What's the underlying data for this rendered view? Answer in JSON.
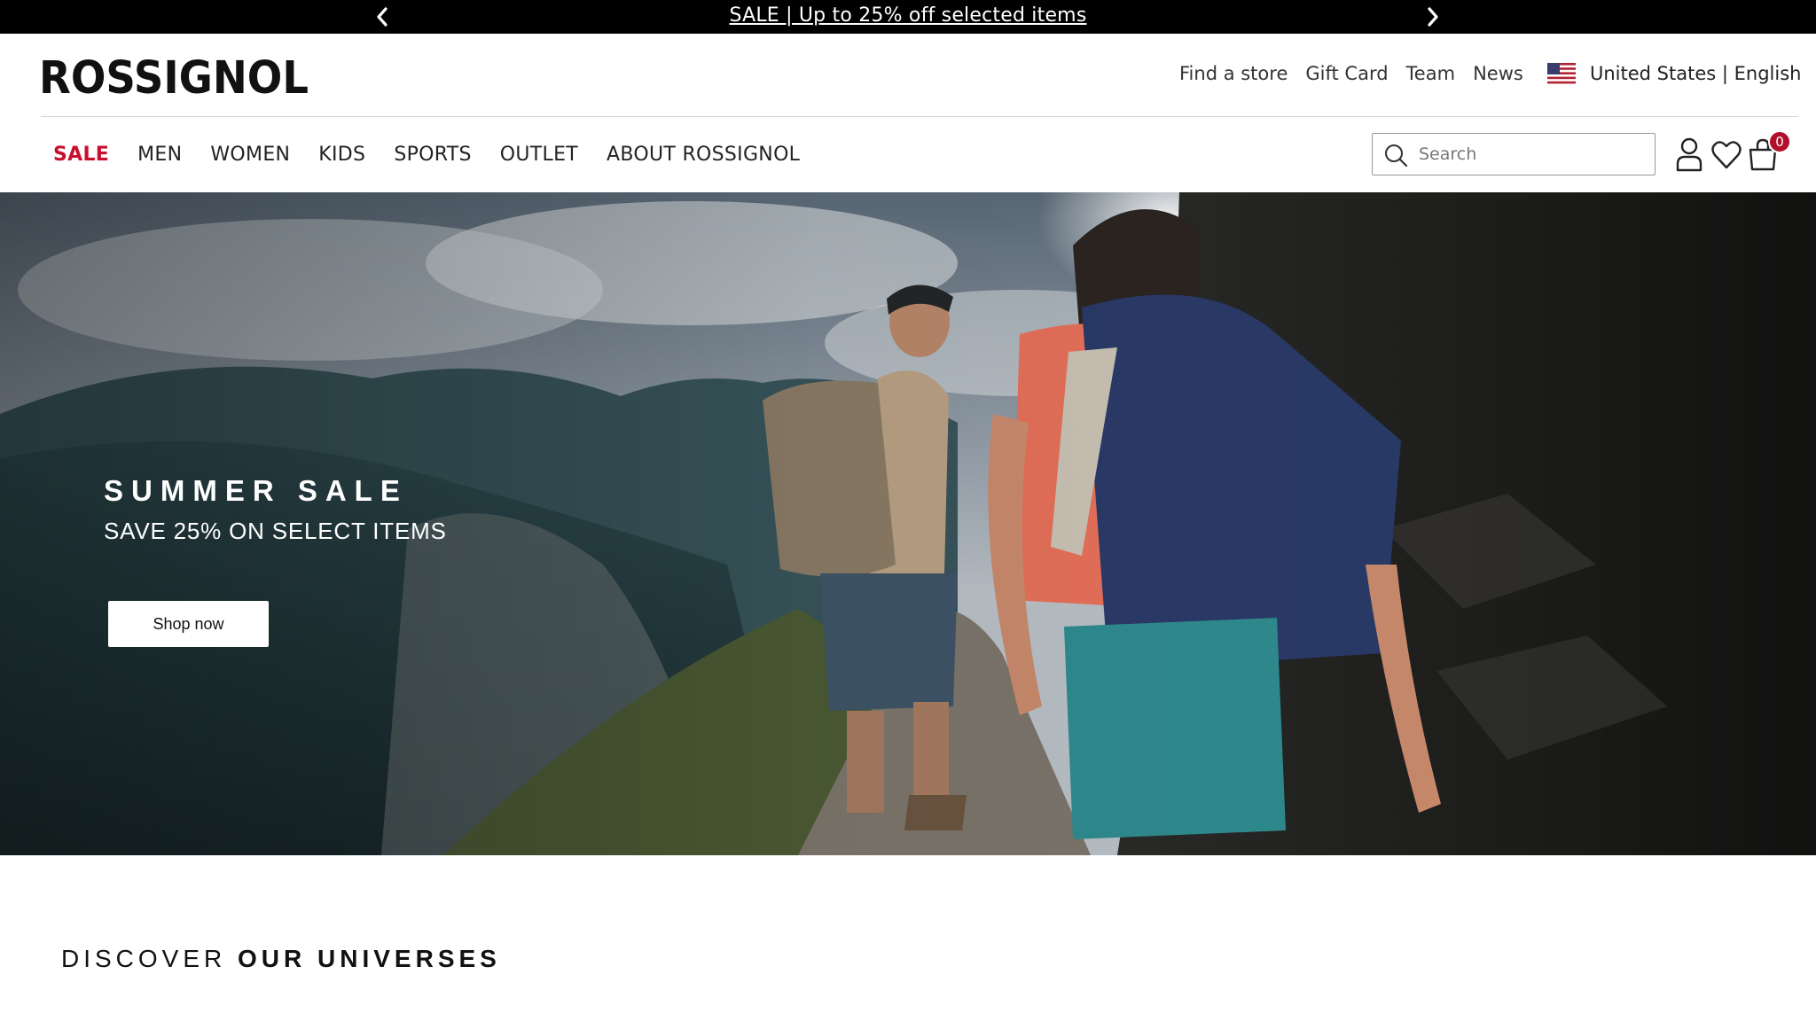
{
  "promo": {
    "text": "SALE | Up to 25% off selected items",
    "prev_icon": "chevron-left-icon",
    "next_icon": "chevron-right-icon"
  },
  "header": {
    "logo_text": "ROSSIGNOL",
    "utility_links": [
      "Find a store",
      "Gift Card",
      "Team",
      "News"
    ],
    "locale": {
      "flag_icon": "us-flag-icon",
      "label": "United States | English"
    }
  },
  "nav": {
    "items": [
      "SALE",
      "MEN",
      "WOMEN",
      "KIDS",
      "SPORTS",
      "OUTLET",
      "ABOUT ROSSIGNOL"
    ],
    "sale_color": "#c8102e"
  },
  "search": {
    "placeholder": "Search",
    "value": ""
  },
  "actions": {
    "account_icon": "user-icon",
    "wishlist_icon": "heart-icon",
    "cart_icon": "shopping-bag-icon",
    "cart_count": "0",
    "badge_color": "#b0102a"
  },
  "hero": {
    "title": "SUMMER SALE",
    "subtitle": "SAVE 25% ON SELECT ITEMS",
    "cta": "Shop now"
  },
  "discover": {
    "light": "DISCOVER ",
    "bold": "OUR UNIVERSES"
  }
}
